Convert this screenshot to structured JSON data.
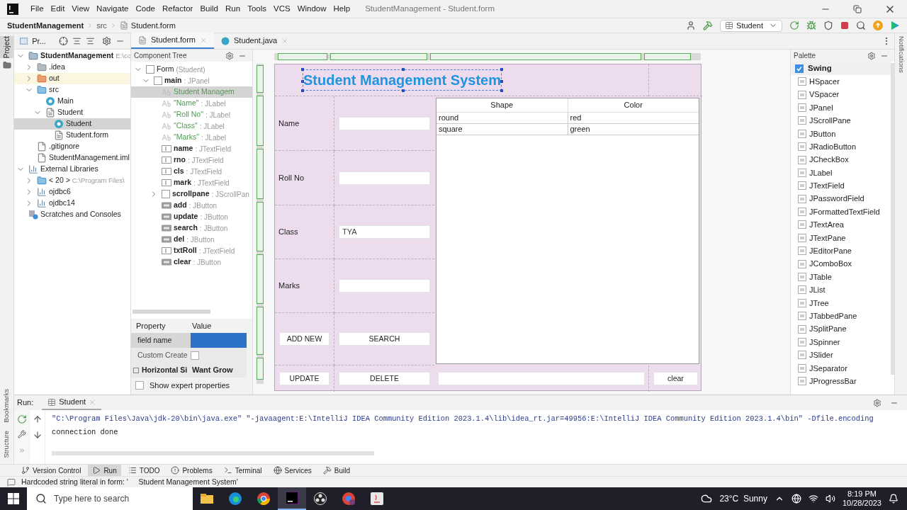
{
  "menu": [
    "File",
    "Edit",
    "View",
    "Navigate",
    "Code",
    "Refactor",
    "Build",
    "Run",
    "Tools",
    "VCS",
    "Window",
    "Help"
  ],
  "window_title": "StudentManagement - Student.form",
  "breadcrumb": [
    "StudentManagement",
    "src",
    "Student.form"
  ],
  "run_config": "Student",
  "left_stripe": {
    "top": [
      {
        "label": "Project",
        "selected": true
      }
    ],
    "bottom": [
      {
        "label": "Bookmarks",
        "selected": false
      },
      {
        "label": "Structure",
        "selected": false
      }
    ]
  },
  "right_stripe": "Notifications",
  "project_panel": {
    "title": "Pr...",
    "tree": [
      {
        "label": "StudentManagement",
        "hint": "E:\\co",
        "kind": "module",
        "expanded": true,
        "selected": false,
        "children": [
          {
            "label": ".idea",
            "kind": "folder",
            "expanded": false,
            "selected": false
          },
          {
            "label": "out",
            "kind": "excluded",
            "expanded": false,
            "selected": false
          },
          {
            "label": "src",
            "kind": "source",
            "expanded": true,
            "selected": false,
            "children": [
              {
                "label": "Main",
                "kind": "class",
                "selected": false
              },
              {
                "label": "Student",
                "kind": "form",
                "expanded": true,
                "selected": false,
                "children": [
                  {
                    "label": "Student",
                    "kind": "class",
                    "selected": true
                  },
                  {
                    "label": "Student.form",
                    "kind": "form",
                    "selected": false
                  }
                ]
              }
            ]
          },
          {
            "label": ".gitignore",
            "kind": "file",
            "selected": false
          },
          {
            "label": "StudentManagement.iml",
            "kind": "file",
            "selected": false
          }
        ]
      },
      {
        "label": "External Libraries",
        "kind": "library",
        "expanded": true,
        "selected": false,
        "children": [
          {
            "label": "< 20 >",
            "hint": "C:\\Program Files\\",
            "kind": "sdk",
            "expanded": false,
            "selected": false
          },
          {
            "label": "ojdbc6",
            "kind": "library",
            "expanded": false,
            "selected": false
          },
          {
            "label": "ojdbc14",
            "kind": "library",
            "expanded": false,
            "selected": false
          }
        ]
      },
      {
        "label": "Scratches and Consoles",
        "kind": "scratch",
        "selected": false
      }
    ]
  },
  "editor_tabs": [
    {
      "label": "Student.form",
      "kind": "form",
      "selected": true
    },
    {
      "label": "Student.java",
      "kind": "class",
      "selected": false
    }
  ],
  "component_tree": {
    "title": "Component Tree",
    "items": [
      {
        "name": "Form",
        "type": "(Student)",
        "kind": "form",
        "expanded": true,
        "selected": false,
        "children": [
          {
            "name": "main",
            "type": ": JPanel",
            "kind": "panel",
            "expanded": true,
            "selected": false,
            "children": [
              {
                "name": "Student Managem",
                "kind": "label",
                "selected": true
              },
              {
                "name": "\"Name\"",
                "type": ": JLabel",
                "kind": "label",
                "selected": false
              },
              {
                "name": "\"Roll No\"",
                "type": ": JLabel",
                "kind": "label",
                "selected": false
              },
              {
                "name": "\"Class\"",
                "type": ": JLabel",
                "kind": "label",
                "selected": false
              },
              {
                "name": "\"Marks\"",
                "type": ": JLabel",
                "kind": "label",
                "selected": false
              },
              {
                "name": "name",
                "type": ": JTextField",
                "kind": "field",
                "selected": false
              },
              {
                "name": "rno",
                "type": ": JTextField",
                "kind": "field",
                "selected": false
              },
              {
                "name": "cls",
                "type": ": JTextField",
                "kind": "field",
                "selected": false
              },
              {
                "name": "mark",
                "type": ": JTextField",
                "kind": "field",
                "selected": false
              },
              {
                "name": "scrollpane",
                "type": ": JScrollPan",
                "kind": "scroll",
                "expanded": false,
                "selected": false
              },
              {
                "name": "add",
                "type": ": JButton",
                "kind": "button",
                "selected": false
              },
              {
                "name": "update",
                "type": ": JButton",
                "kind": "button",
                "selected": false
              },
              {
                "name": "search",
                "type": ": JButton",
                "kind": "button",
                "selected": false
              },
              {
                "name": "del",
                "type": ": JButton",
                "kind": "button",
                "selected": false
              },
              {
                "name": "txtRoll",
                "type": ": JTextField",
                "kind": "field",
                "selected": false
              },
              {
                "name": "clear",
                "type": ": JButton",
                "kind": "button",
                "selected": false
              }
            ]
          }
        ]
      }
    ]
  },
  "properties": {
    "columns": [
      "Property",
      "Value"
    ],
    "rows": [
      {
        "name": "field name",
        "kind": "text",
        "selected": true
      },
      {
        "name": "Custom Create",
        "kind": "checkbox",
        "checked": false,
        "selected": false
      },
      {
        "name": "Horizontal Si",
        "kind": "group",
        "value": "Want Grow",
        "selected": false
      }
    ],
    "expert": {
      "label": "Show expert properties",
      "checked": false
    }
  },
  "form": {
    "title": "Student Management System",
    "title_selected": true,
    "fields": [
      {
        "label": "Name"
      },
      {
        "label": "Roll No"
      },
      {
        "label": "Class",
        "value": "TYA"
      },
      {
        "label": "Marks"
      }
    ],
    "buttons": [
      "ADD NEW",
      "SEARCH"
    ],
    "bottom_buttons": [
      "UPDATE",
      "DELETE"
    ],
    "clear_button": "clear",
    "table": {
      "columns": [
        "Shape",
        "Color"
      ],
      "rows": [
        [
          "round",
          "red"
        ],
        [
          "square",
          "green"
        ]
      ]
    }
  },
  "palette": {
    "title": "Palette",
    "group": {
      "label": "Swing",
      "checked": true
    },
    "items": [
      "HSpacer",
      "VSpacer",
      "JPanel",
      "JScrollPane",
      "JButton",
      "JRadioButton",
      "JCheckBox",
      "JLabel",
      "JTextField",
      "JPasswordField",
      "JFormattedTextField",
      "JTextArea",
      "JTextPane",
      "JEditorPane",
      "JComboBox",
      "JTable",
      "JList",
      "JTree",
      "JTabbedPane",
      "JSplitPane",
      "JSpinner",
      "JSlider",
      "JSeparator",
      "JProgressBar"
    ]
  },
  "run": {
    "label": "Run:",
    "tab": "Student",
    "lines": [
      "\"C:\\Program Files\\Java\\jdk-20\\bin\\java.exe\" \"-javaagent:E:\\IntelliJ IDEA Community Edition 2023.1.4\\lib\\idea_rt.jar=49956:E:\\IntelliJ IDEA Community Edition 2023.1.4\\bin\" -Dfile.encoding",
      "connection done"
    ]
  },
  "tool_windows": [
    {
      "label": "Version Control",
      "kind": "vcs",
      "selected": false
    },
    {
      "label": "Run",
      "kind": "run",
      "selected": true
    },
    {
      "label": "TODO",
      "kind": "todo",
      "selected": false
    },
    {
      "label": "Problems",
      "kind": "problems",
      "selected": false
    },
    {
      "label": "Terminal",
      "kind": "terminal",
      "selected": false
    },
    {
      "label": "Services",
      "kind": "services",
      "selected": false
    },
    {
      "label": "Build",
      "kind": "build",
      "selected": false
    }
  ],
  "status": "Hardcoded string literal in form: '     Student Management System'",
  "taskbar": {
    "search_placeholder": "Type here to search",
    "weather": "23°C  Sunny",
    "time": "8:19 PM",
    "date": "10/28/2023"
  }
}
